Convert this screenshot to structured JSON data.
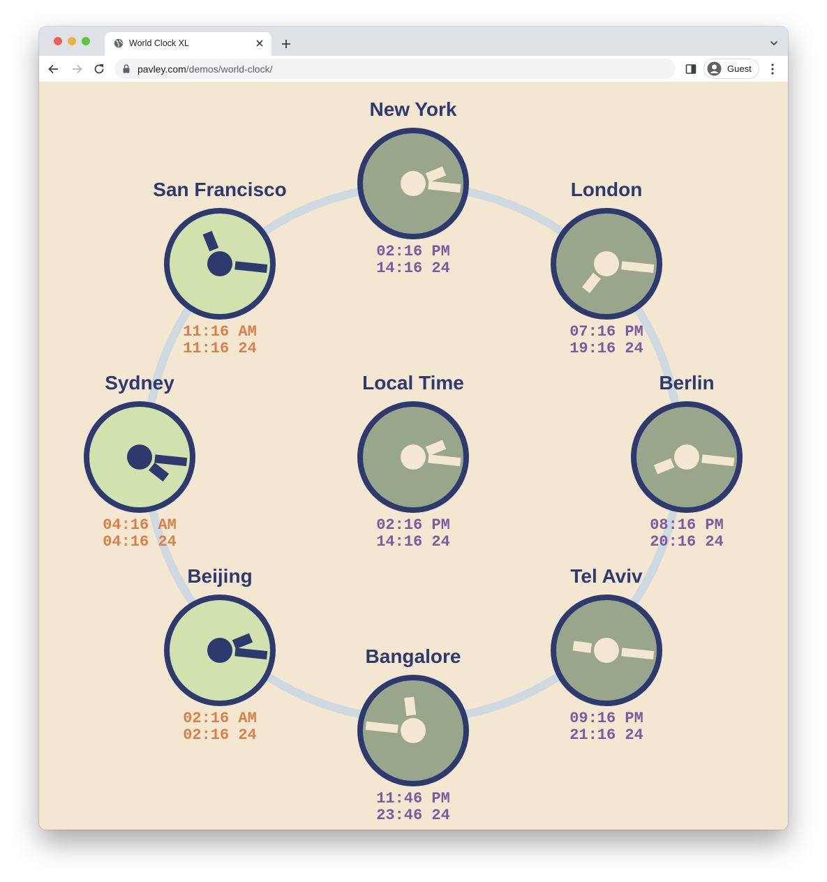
{
  "browser": {
    "tab_title": "World Clock XL",
    "url_domain": "pavley.com",
    "url_path": "/demos/world-clock/",
    "profile_label": "Guest",
    "icons": {
      "tab_favicon": "globe-icon",
      "tab_close": "close-icon",
      "new_tab": "plus-icon",
      "tab_search": "chevron-down-icon",
      "back": "arrow-left-icon",
      "forward": "arrow-right-icon",
      "reload": "reload-icon",
      "lock": "lock-icon",
      "side_panel": "side-panel-icon",
      "profile": "user-circle-icon",
      "menu": "more-vertical-icon"
    }
  },
  "colors": {
    "page_background": "#f3e7d2",
    "ring": "#cfdae0",
    "title": "#2e3a6e",
    "night_face": "#9aa68c",
    "night_hands": "#f3e7d2",
    "night_text": "#7b5aa0",
    "day_face": "#d1e2ae",
    "day_hands": "#2e3a6e",
    "day_text": "#d8804a",
    "rim": "#2e3a6e"
  },
  "clocks": [
    {
      "id": "new-york",
      "name": "New York",
      "time12": "02:16 PM",
      "time24": "14:16 24",
      "hour": 14,
      "minute": 16,
      "theme": "night"
    },
    {
      "id": "london",
      "name": "London",
      "time12": "07:16 PM",
      "time24": "19:16 24",
      "hour": 19,
      "minute": 16,
      "theme": "night"
    },
    {
      "id": "berlin",
      "name": "Berlin",
      "time12": "08:16 PM",
      "time24": "20:16 24",
      "hour": 20,
      "minute": 16,
      "theme": "night"
    },
    {
      "id": "tel-aviv",
      "name": "Tel Aviv",
      "time12": "09:16 PM",
      "time24": "21:16 24",
      "hour": 21,
      "minute": 16,
      "theme": "night"
    },
    {
      "id": "bangalore",
      "name": "Bangalore",
      "time12": "11:46 PM",
      "time24": "23:46 24",
      "hour": 23,
      "minute": 46,
      "theme": "night"
    },
    {
      "id": "beijing",
      "name": "Beijing",
      "time12": "02:16 AM",
      "time24": "02:16 24",
      "hour": 2,
      "minute": 16,
      "theme": "day"
    },
    {
      "id": "sydney",
      "name": "Sydney",
      "time12": "04:16 AM",
      "time24": "04:16 24",
      "hour": 4,
      "minute": 16,
      "theme": "day"
    },
    {
      "id": "san-francisco",
      "name": "San Francisco",
      "time12": "11:16 AM",
      "time24": "11:16 24",
      "hour": 11,
      "minute": 16,
      "theme": "day"
    },
    {
      "id": "local-time",
      "name": "Local Time",
      "time12": "02:16 PM",
      "time24": "14:16 24",
      "hour": 14,
      "minute": 16,
      "theme": "night"
    }
  ]
}
